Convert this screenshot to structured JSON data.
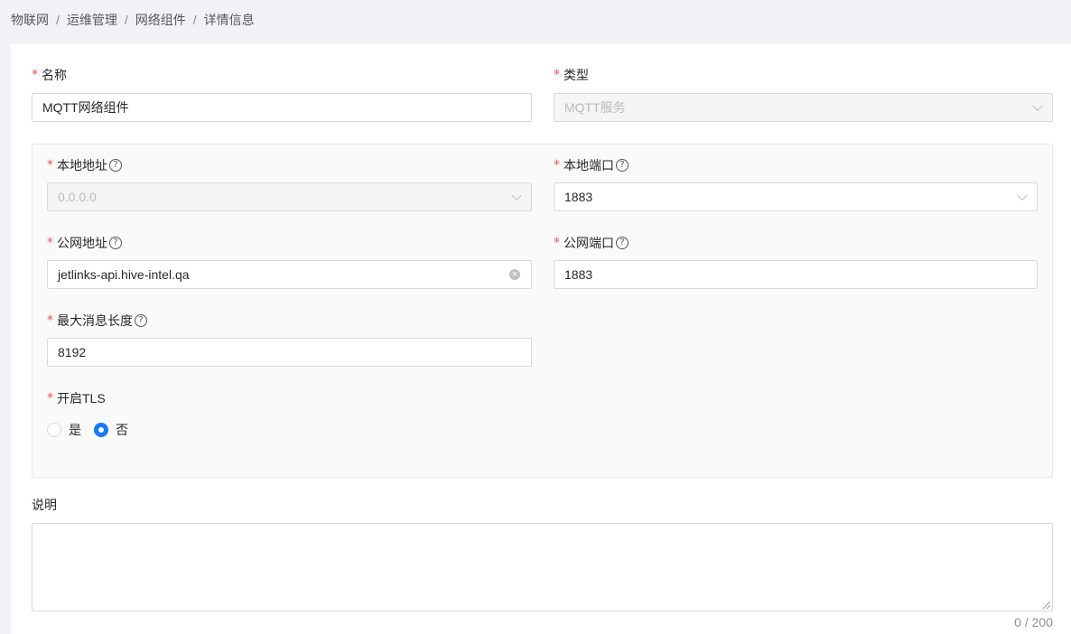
{
  "breadcrumb": {
    "items": [
      "物联网",
      "运维管理",
      "网络组件",
      "详情信息"
    ],
    "separator": "/"
  },
  "form": {
    "name": {
      "label": "名称",
      "value": "MQTT网络组件"
    },
    "type": {
      "label": "类型",
      "value": "MQTT服务"
    },
    "local_address": {
      "label": "本地地址",
      "value": "0.0.0.0"
    },
    "local_port": {
      "label": "本地端口",
      "value": "1883"
    },
    "public_address": {
      "label": "公网地址",
      "value": "jetlinks-api.hive-intel.qa"
    },
    "public_port": {
      "label": "公网端口",
      "value": "1883"
    },
    "max_message_length": {
      "label": "最大消息长度",
      "value": "8192"
    },
    "tls": {
      "label": "开启TLS",
      "options": [
        "是",
        "否"
      ],
      "selected": "否"
    },
    "description": {
      "label": "说明",
      "value": "",
      "counter": "0 / 200"
    }
  },
  "required_mark": "*",
  "help_mark": "?",
  "clear_mark": "×",
  "colors": {
    "primary": "#1677ff",
    "required": "#ff4d4f",
    "page_bg": "#f0f2f5"
  },
  "icons": [
    "question-circle-icon",
    "chevron-down-icon",
    "close-circle-icon"
  ]
}
